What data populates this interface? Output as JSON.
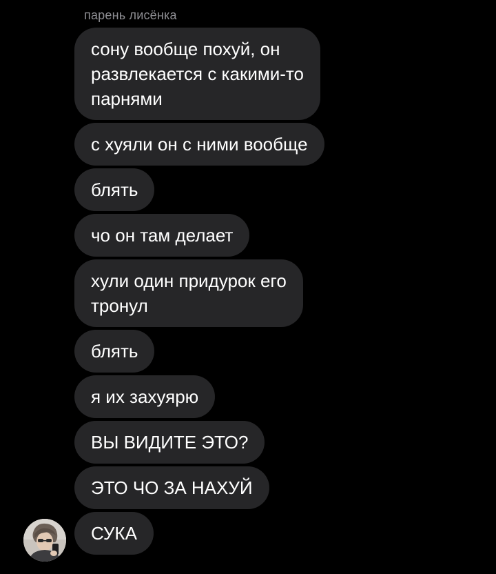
{
  "chat": {
    "sender_name": "парень лисёнка",
    "messages": [
      "сону вообще похуй, он\nразвлекается с какими-то\nпарнями",
      "с хуяли он с ними вообще",
      "блять",
      "чо он там делает",
      "хули один придурок его\nтронул",
      "блять",
      "я их захуярю",
      "ВЫ ВИДИТЕ ЭТО?",
      "ЭТО ЧО ЗА НАХУЙ",
      "СУКА"
    ]
  },
  "colors": {
    "background": "#000000",
    "bubble": "#262628",
    "text": "#ffffff",
    "sender_name": "#8e8e93"
  },
  "icons": {
    "avatar": "profile-photo-avatar"
  }
}
